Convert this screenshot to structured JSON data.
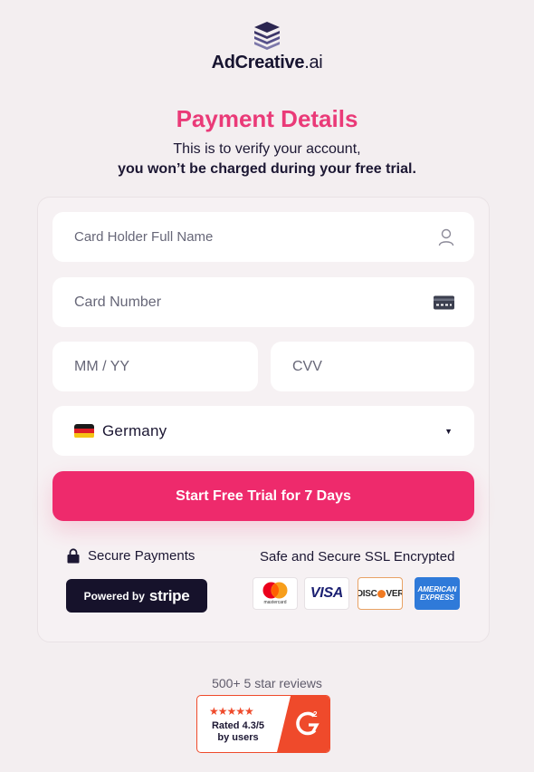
{
  "brand": {
    "name_main": "AdCreative",
    "name_suffix": ".ai"
  },
  "heading": {
    "title": "Payment Details",
    "line1": "This is to verify your account,",
    "line2": "you won’t be charged during your free trial."
  },
  "form": {
    "holder_placeholder": "Card Holder Full Name",
    "number_placeholder": "Card Number",
    "expiry_placeholder": "MM / YY",
    "cvv_placeholder": "CVV",
    "country_value": "Germany",
    "submit_label": "Start Free Trial for 7 Days"
  },
  "security": {
    "secure_label": "Secure Payments",
    "ssl_label": "Safe and Secure SSL Encrypted",
    "powered_by": "Powered by",
    "stripe": "stripe",
    "cards": {
      "mastercard": "mastercard",
      "visa": "VISA",
      "discover_a": "DISC",
      "discover_b": "VER",
      "amex_a": "AMERICAN",
      "amex_b": "EXPRESS"
    }
  },
  "reviews": {
    "count_label": "500+ 5 star reviews",
    "stars": "★★★★★",
    "rating_line1": "Rated 4.3/5",
    "rating_line2": "by users",
    "badge": "G2"
  },
  "colors": {
    "accent": "#ee2a6c",
    "title": "#ea3a78",
    "dark": "#1c1733",
    "g2_orange": "#ef4a2b"
  },
  "icons": [
    "logo-stack-icon",
    "user-icon",
    "credit-card-icon",
    "germany-flag-icon",
    "chevron-down-icon",
    "lock-icon",
    "g2-logo-icon"
  ]
}
